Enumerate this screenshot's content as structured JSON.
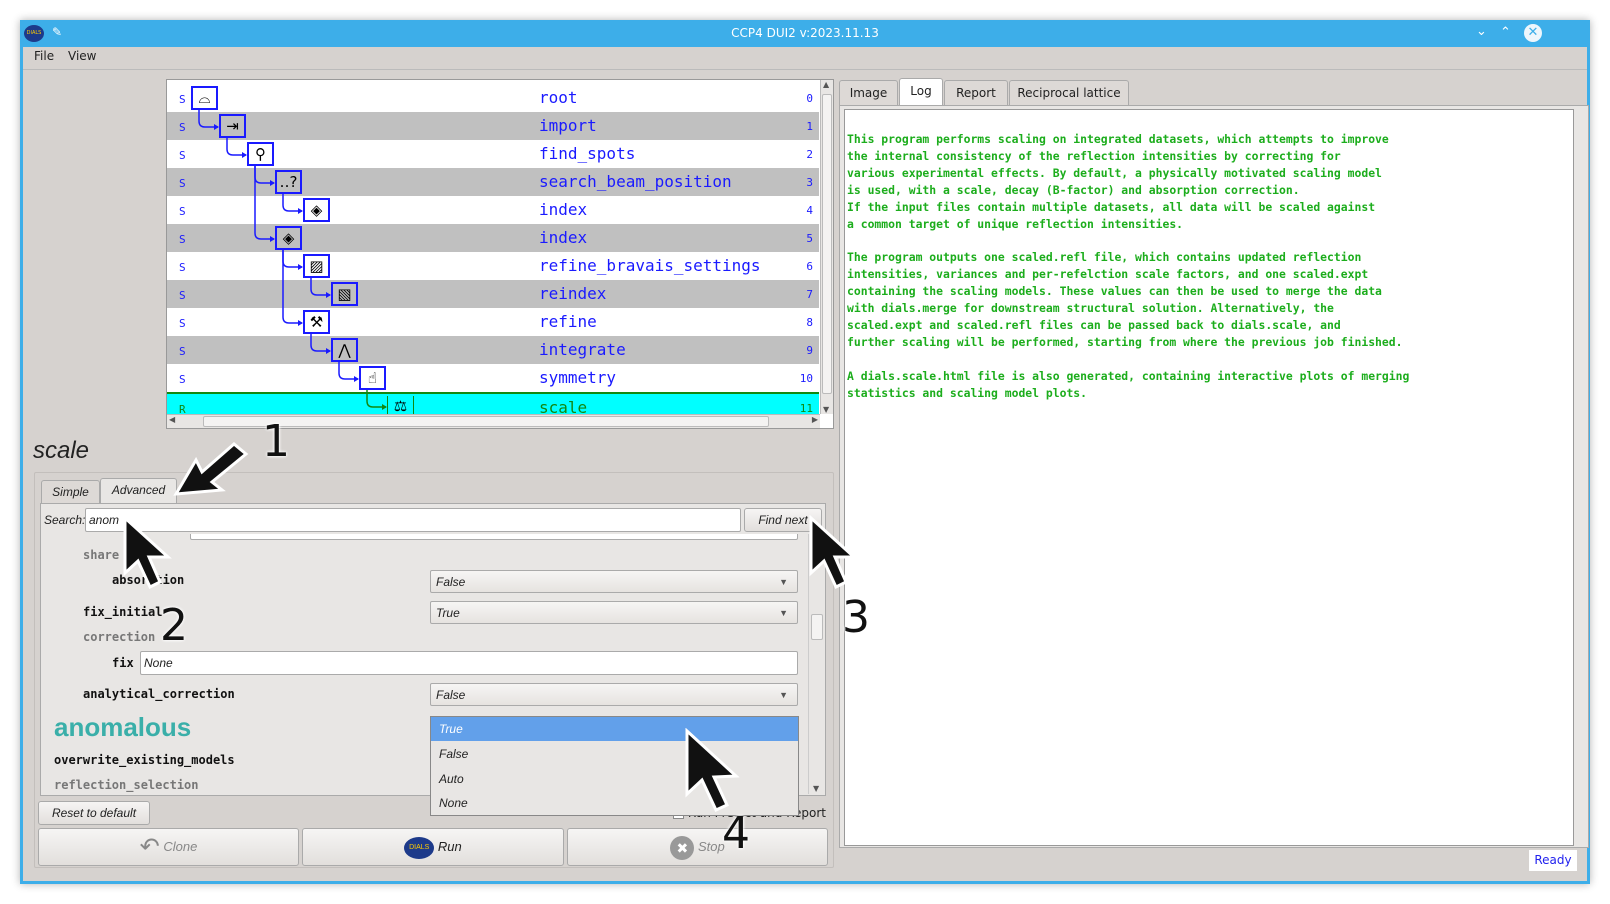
{
  "window": {
    "title": "CCP4 DUI2 v:2023.11.13",
    "app_icon": "dials-logo-icon",
    "pin_icon": "pin-icon",
    "controls": [
      "minimize-icon",
      "maximize-icon",
      "close-icon"
    ],
    "accent": "#3daee9"
  },
  "menu": {
    "items": [
      "File",
      "View"
    ]
  },
  "tree": {
    "nodes": [
      {
        "status": "S",
        "label": "root",
        "number": "0",
        "level": 0,
        "parent": null,
        "icon": "root-icon",
        "glyph": "⌓"
      },
      {
        "status": "S",
        "label": "import",
        "number": "1",
        "level": 1,
        "parent": 0,
        "icon": "import-icon",
        "glyph": "⇥"
      },
      {
        "status": "S",
        "label": "find_spots",
        "number": "2",
        "level": 2,
        "parent": 1,
        "icon": "find-spots-icon",
        "glyph": "⚲"
      },
      {
        "status": "S",
        "label": "search_beam_position",
        "number": "3",
        "level": 3,
        "parent": 2,
        "icon": "search-beam-icon",
        "glyph": "‥?"
      },
      {
        "status": "S",
        "label": "index",
        "number": "4",
        "level": 4,
        "parent": 3,
        "icon": "index-icon",
        "glyph": "◈"
      },
      {
        "status": "S",
        "label": "index",
        "number": "5",
        "level": 3,
        "parent": 2,
        "icon": "index-icon",
        "glyph": "◈"
      },
      {
        "status": "S",
        "label": "refine_bravais_settings",
        "number": "6",
        "level": 4,
        "parent": 5,
        "icon": "refine-bravais-icon",
        "glyph": "▨"
      },
      {
        "status": "S",
        "label": "reindex",
        "number": "7",
        "level": 5,
        "parent": 6,
        "icon": "reindex-icon",
        "glyph": "▧"
      },
      {
        "status": "S",
        "label": "refine",
        "number": "8",
        "level": 4,
        "parent": 5,
        "icon": "wrench-icon",
        "glyph": "⚒"
      },
      {
        "status": "S",
        "label": "integrate",
        "number": "9",
        "level": 5,
        "parent": 8,
        "icon": "integrate-icon",
        "glyph": "⋀"
      },
      {
        "status": "S",
        "label": "symmetry",
        "number": "10",
        "level": 6,
        "parent": 9,
        "icon": "thumbs-icon",
        "glyph": "☝"
      },
      {
        "status": "R",
        "label": "scale",
        "number": "11",
        "level": 7,
        "parent": 10,
        "icon": "balance-scale-icon",
        "glyph": "⚖"
      }
    ],
    "current": 11,
    "link_color": "#1a1aff",
    "current_color": "#00ffff"
  },
  "params": {
    "heading": "scale",
    "tabs": [
      "Simple",
      "Advanced"
    ],
    "active_tab": "Advanced",
    "search_label": "Search:",
    "search_value": "anom",
    "find_next": "Find next",
    "rows": {
      "share": "share",
      "absorption": "absorption",
      "absorption_value": "False",
      "fix_initial": "fix_initial",
      "fix_initial_value": "True",
      "correction": "correction",
      "fix": "fix",
      "fix_value": "None",
      "analytical_correction": "analytical_correction",
      "analytical_correction_value": "False",
      "anomalous": "anomalous",
      "overwrite_existing_models": "overwrite_existing_models",
      "reflection_selection": "reflection_selection"
    },
    "dropdown": {
      "options": [
        "True",
        "False",
        "Auto",
        "None"
      ],
      "highlighted": "True"
    },
    "reset": "Reset to default",
    "run_predict": "Run Predict and Report",
    "clone": "Clone",
    "run": "Run",
    "stop": "Stop",
    "anomalous_color": "#3aafa9"
  },
  "right": {
    "tabs": [
      "Image",
      "Log",
      "Report",
      "Reciprocal lattice"
    ],
    "active_tab": "Log",
    "log": "This program performs scaling on integrated datasets, which attempts to improve\nthe internal consistency of the reflection intensities by correcting for\nvarious experimental effects. By default, a physically motivated scaling model\nis used, with a scale, decay (B-factor) and absorption correction.\nIf the input files contain multiple datasets, all data will be scaled against\na common target of unique reflection intensities.\n\nThe program outputs one scaled.refl file, which contains updated reflection\nintensities, variances and per-refelction scale factors, and one scaled.expt\ncontaining the scaling models. These values can then be used to merge the data\nwith dials.merge for downstream structural solution. Alternatively, the\nscaled.expt and scaled.refl files can be passed back to dials.scale, and\nfurther scaling will be performed, starting from where the previous job finished.\n\nA dials.scale.html file is also generated, containing interactive plots of merging\nstatistics and scaling model plots.",
    "log_color": "#1cad1c"
  },
  "status": "Ready",
  "annotations": [
    "1",
    "2",
    "3",
    "4"
  ]
}
